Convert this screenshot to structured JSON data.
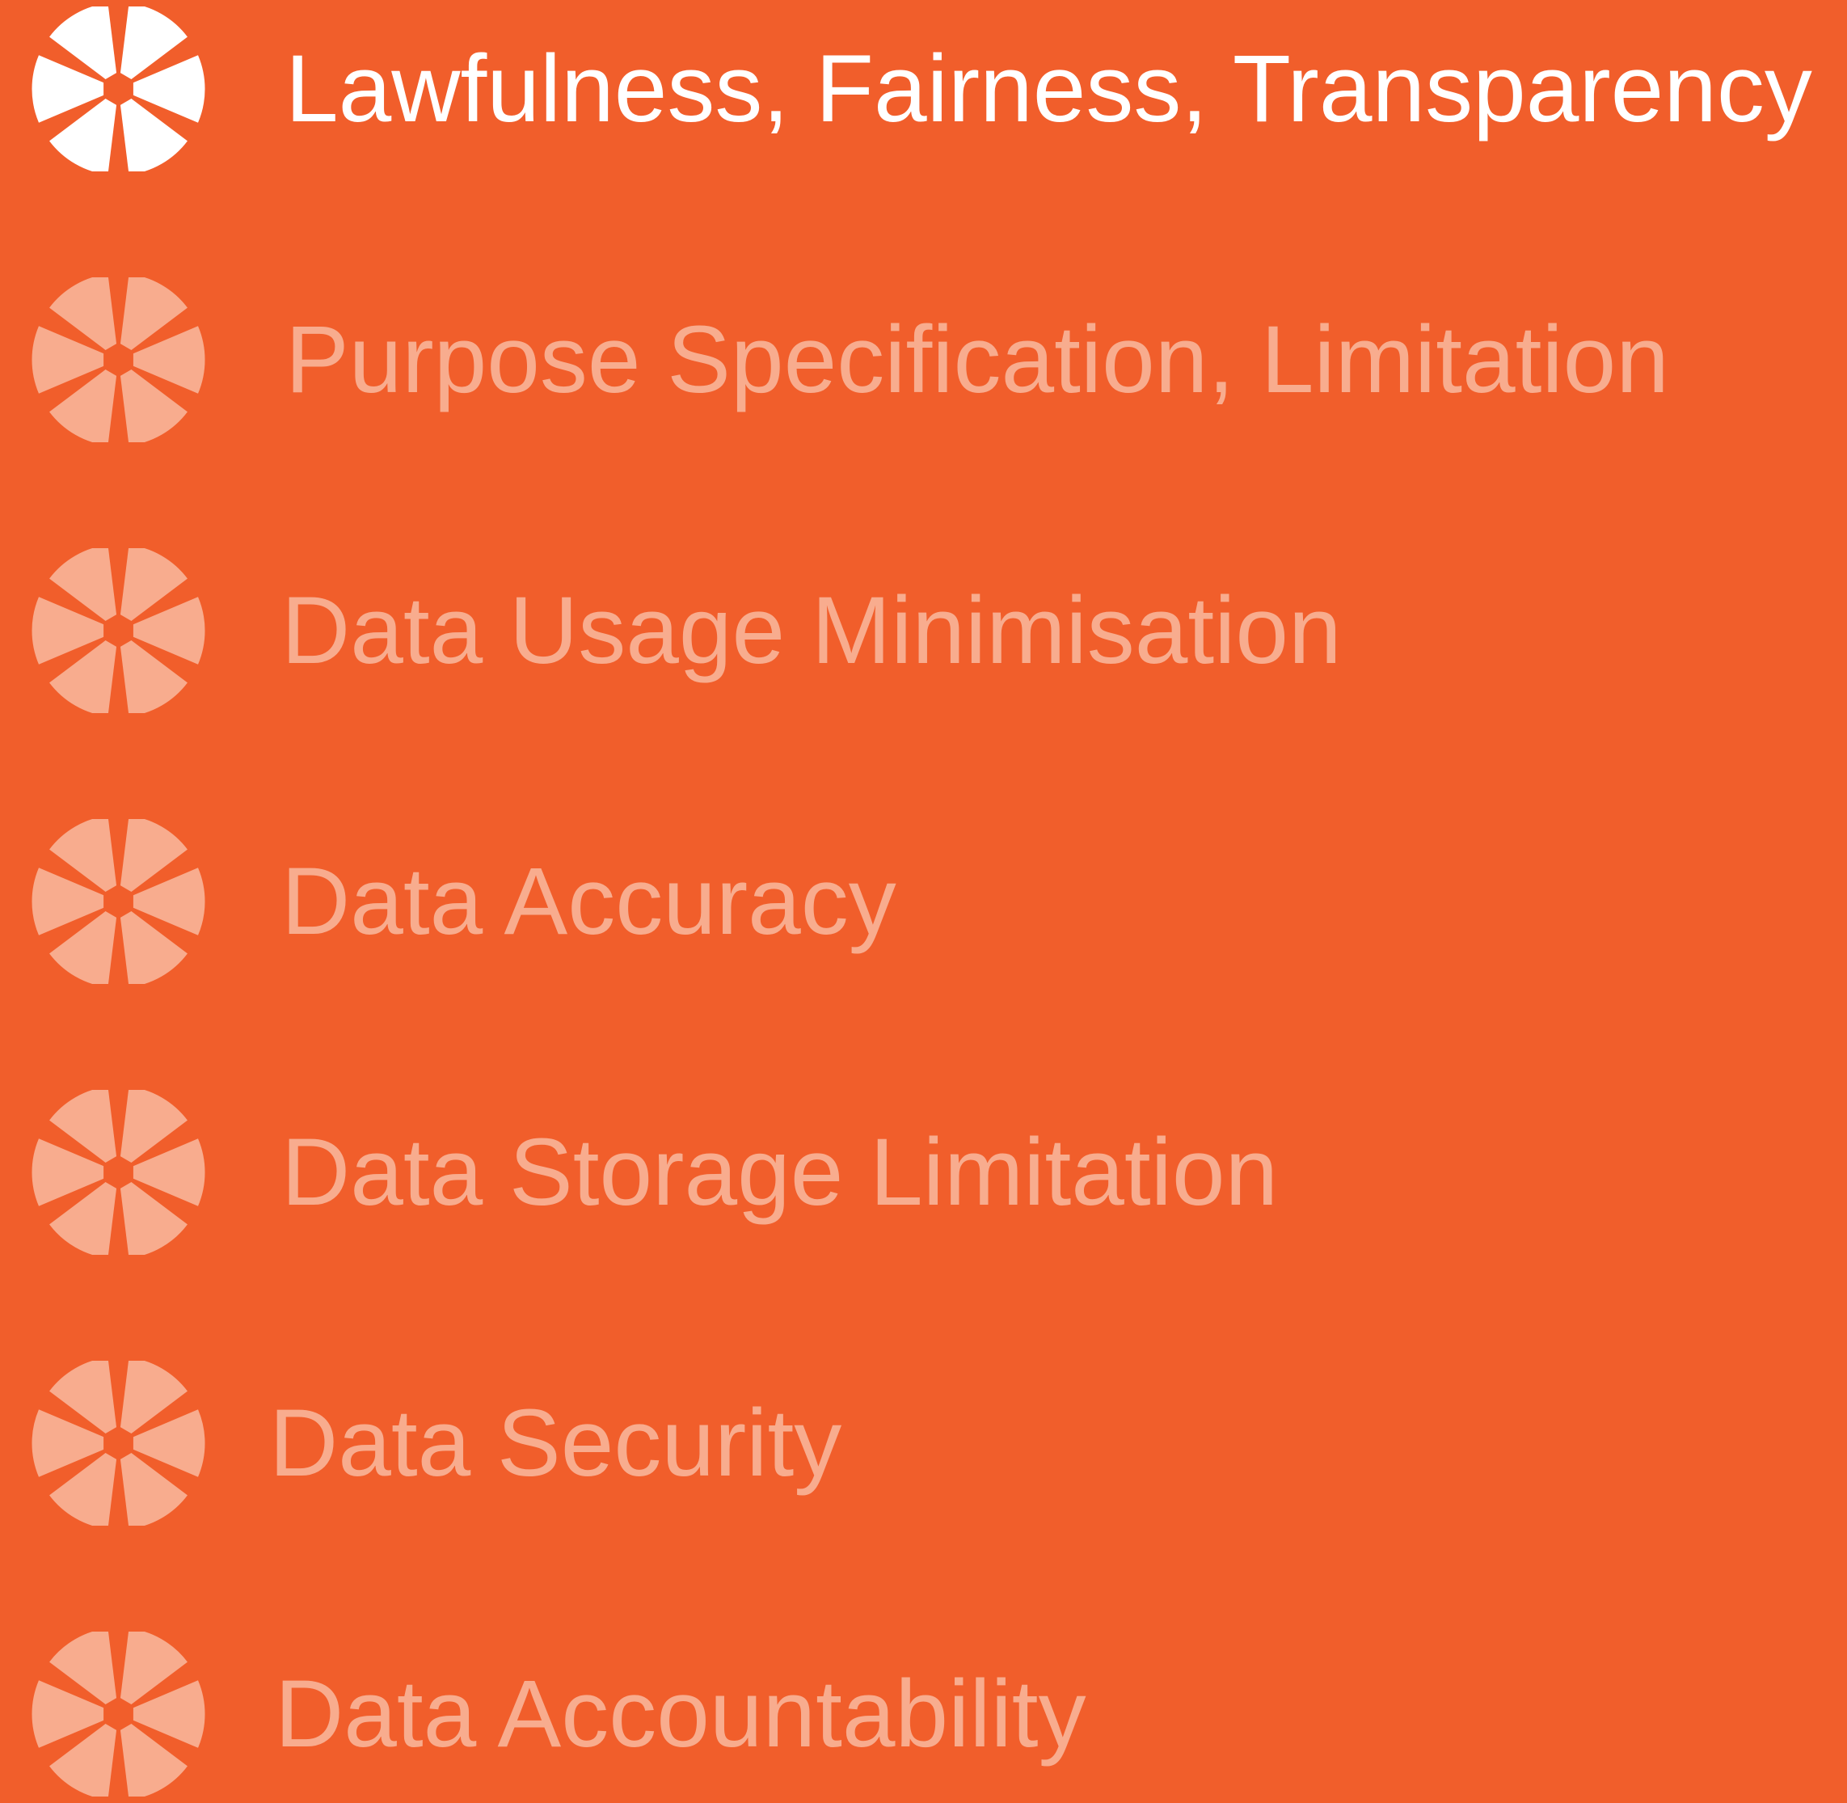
{
  "colors": {
    "background": "#F15E2B",
    "active_text": "#FFFFFF",
    "inactive_text": "#F8AC8E",
    "active_icon": "#FFFFFF",
    "inactive_icon": "#F8AC8E"
  },
  "principles": [
    {
      "label": "Lawfulness, Fairness, Transparency",
      "icon": "segmented-circle-icon",
      "state": "active"
    },
    {
      "label": "Purpose Specification, Limitation",
      "icon": "segmented-circle-icon",
      "state": "inactive"
    },
    {
      "label": "Data Usage Minimisation",
      "icon": "segmented-circle-icon",
      "state": "inactive"
    },
    {
      "label": "Data Accuracy",
      "icon": "segmented-circle-icon",
      "state": "inactive"
    },
    {
      "label": "Data Storage Limitation",
      "icon": "segmented-circle-icon",
      "state": "inactive"
    },
    {
      "label": "Data Security",
      "icon": "segmented-circle-icon",
      "state": "inactive"
    },
    {
      "label": "Data Accountability",
      "icon": "segmented-circle-icon",
      "state": "inactive"
    }
  ]
}
